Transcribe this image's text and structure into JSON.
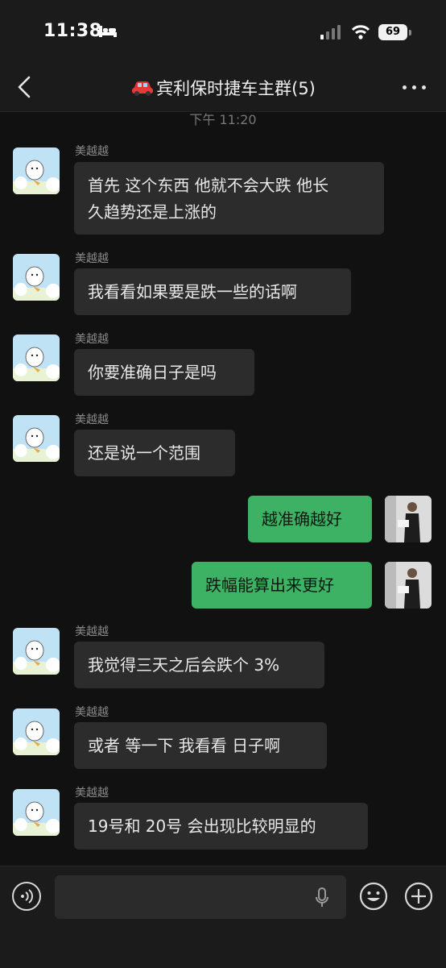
{
  "status_bar": {
    "time": "11:38",
    "battery": "69"
  },
  "header": {
    "title": "宾利保时捷车主群(5)",
    "back_icon": "chevron-left-icon",
    "more_icon": "more-icon"
  },
  "chat": {
    "timestamp": "下午 11:20",
    "messages": [
      {
        "sender": "美越越",
        "side": "left",
        "lines": [
          "首先 这个东西 他就不会大跌 他长",
          "久趋势还是上涨的"
        ]
      },
      {
        "sender": "美越越",
        "side": "left",
        "lines": [
          "我看看如果要是跌一些的话啊"
        ]
      },
      {
        "sender": "美越越",
        "side": "left",
        "lines": [
          "你要准确日子是吗"
        ]
      },
      {
        "sender": "美越越",
        "side": "left",
        "lines": [
          "还是说一个范围"
        ]
      },
      {
        "sender": "",
        "side": "right",
        "lines": [
          "越准确越好"
        ]
      },
      {
        "sender": "",
        "side": "right",
        "lines": [
          "跌幅能算出来更好"
        ]
      },
      {
        "sender": "美越越",
        "side": "left",
        "lines": [
          "我觉得三天之后会跌个 3%"
        ]
      },
      {
        "sender": "美越越",
        "side": "left",
        "lines": [
          "或者 等一下 我看看 日子啊"
        ]
      },
      {
        "sender": "美越越",
        "side": "left",
        "lines": [
          "19号和 20号 会出现比较明显的"
        ]
      }
    ]
  },
  "input_bar": {
    "voice_icon": "voice-icon",
    "mic_icon": "mic-icon",
    "emoji_icon": "emoji-icon",
    "plus_icon": "plus-icon",
    "input_value": ""
  },
  "colors": {
    "background": "#111111",
    "bubble_in": "#2c2c2c",
    "bubble_out": "#3eb264"
  }
}
